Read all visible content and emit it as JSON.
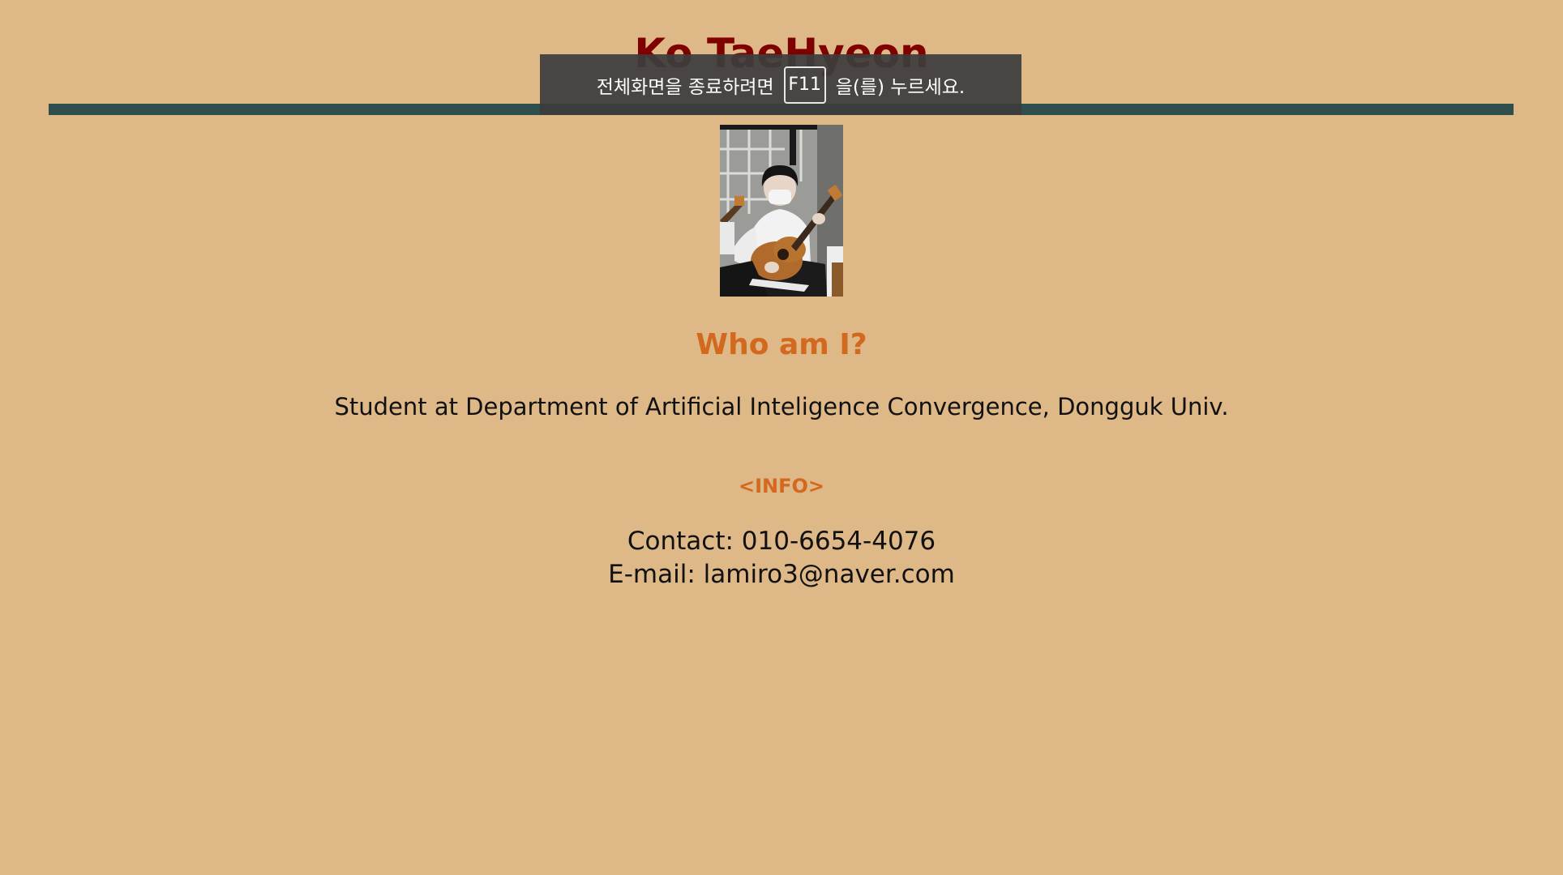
{
  "page": {
    "title": "Ko TaeHyeon",
    "background_color": "#DEB887",
    "title_color": "#800000",
    "divider_color": "#2F4F4F",
    "heading_color": "#D2691E"
  },
  "profile": {
    "photo": "profile-photo-guitar"
  },
  "about": {
    "heading": "Who am I?",
    "bio": "Student at Department of Artificial Inteligence Convergence, Dongguk Univ."
  },
  "info": {
    "heading": "<INFO>",
    "contact_line": "Contact: 010-6654-4076",
    "email_line": "E-mail: lamiro3@naver.com"
  },
  "fullscreen_notice": {
    "before_key": "전체화면을 종료하려면",
    "key": "F11",
    "after_key": "을(를) 누르세요."
  }
}
